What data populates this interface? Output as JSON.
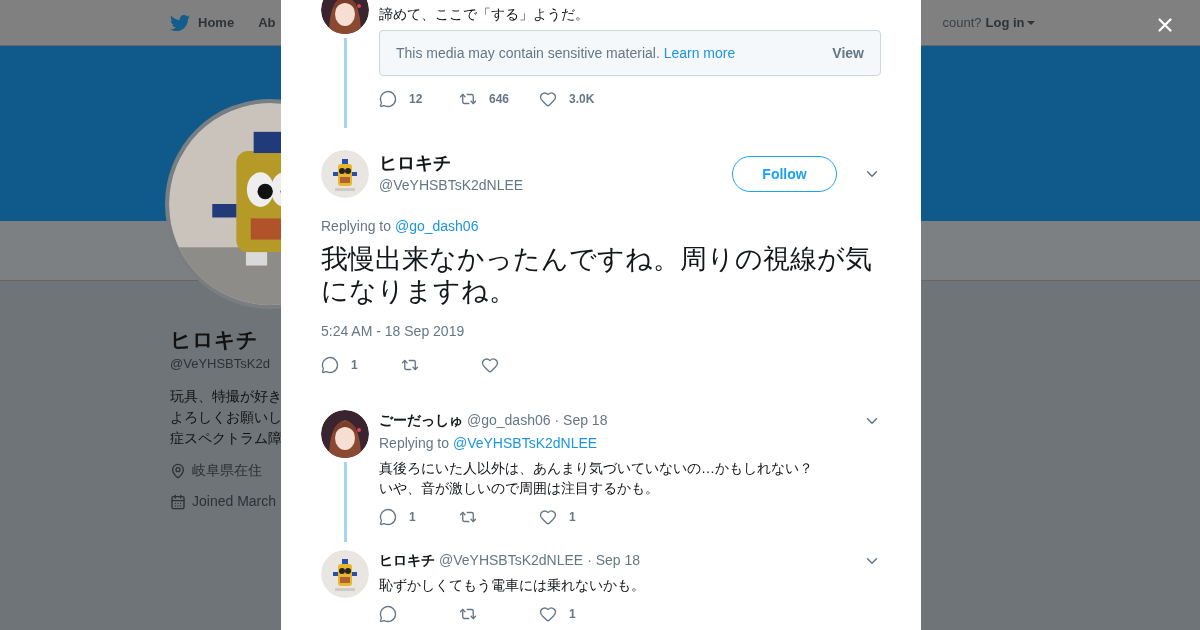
{
  "background": {
    "nav": [
      {
        "label": "Home",
        "kind": "logo"
      },
      {
        "label": "Ab",
        "kind": "plain"
      }
    ],
    "login_prompt": "count?",
    "login": "Log in",
    "profile": {
      "name": "ヒロキチ",
      "handle": "@VeYHSBTsK2d",
      "bio": [
        "玩具、特撮が好き",
        "よろしくお願いし",
        "症スペクトラム障"
      ],
      "location": "岐阜県在住",
      "joined": "Joined March"
    }
  },
  "modal": {
    "top_tweet": {
      "avatar": {
        "kind": "girl"
      },
      "text": "諦めて、ここで「する」ようだ。",
      "sensitive": {
        "text": "This media may contain sensitive material.",
        "link": "Learn more",
        "button": "View"
      },
      "actions": {
        "replies": "12",
        "retweets": "646",
        "likes": "3.0K"
      }
    },
    "main_tweet": {
      "avatar": {
        "kind": "robot"
      },
      "name": "ヒロキチ",
      "handle": "@VeYHSBTsK2dNLEE",
      "follow": "Follow",
      "replying_label": "Replying to",
      "replying_to": "@go_dash06",
      "text": "我慢出来なかったんですね。周りの視線が気になりますね。",
      "timestamp": "5:24 AM - 18 Sep 2019",
      "actions": {
        "replies": "1"
      }
    },
    "replies": [
      {
        "avatar": {
          "kind": "girl"
        },
        "name": "ごーだっしゅ",
        "handle": "@go_dash06",
        "date": "· Sep 18",
        "replying_label": "Replying to",
        "replying_to": "@VeYHSBTsK2dNLEE",
        "lines": [
          "真後ろにいた人以外は、あんまり気づいていないの…かもしれない？",
          "いや、音が激しいので周囲は注目するかも。"
        ],
        "thread": true,
        "actions": {
          "replies": "1",
          "likes": "1"
        }
      },
      {
        "avatar": {
          "kind": "robot"
        },
        "name": "ヒロキチ",
        "handle": "@VeYHSBTsK2dNLEE",
        "date": "· Sep 18",
        "lines": [
          "恥ずかしくてもう電車には乗れないかも。"
        ],
        "thread": false,
        "actions": {
          "likes": "1"
        }
      }
    ]
  }
}
